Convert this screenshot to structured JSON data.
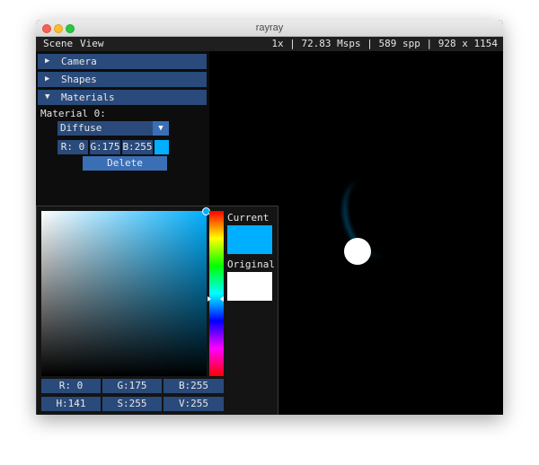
{
  "window": {
    "title": "rayray"
  },
  "menubar": {
    "items": [
      "Scene",
      "View"
    ],
    "stats": "1x | 72.83 Msps | 589 spp | 928 x 1154"
  },
  "panel": {
    "headers": [
      {
        "label": "Camera",
        "expanded": false
      },
      {
        "label": "Shapes",
        "expanded": false
      },
      {
        "label": "Materials",
        "expanded": true
      }
    ],
    "material_label": "Material 0:",
    "type_select": {
      "value": "Diffuse"
    },
    "rgb": {
      "r": "R:  0",
      "g": "G:175",
      "b": "B:255",
      "swatch_color": "#00afff"
    },
    "delete_label": "Delete"
  },
  "picker": {
    "current_label": "Current",
    "original_label": "Original",
    "current_color": "#00afff",
    "original_color": "#ffffff",
    "rgb": {
      "r": "R:  0",
      "g": "G:175",
      "b": "B:255"
    },
    "hsv": {
      "h": "H:141",
      "s": "S:255",
      "v": "V:255"
    },
    "hex": "#00AFFF"
  },
  "icons": {
    "collapsed": "triangle-right-icon",
    "expanded": "triangle-down-icon",
    "combo": "triangle-down-icon"
  }
}
